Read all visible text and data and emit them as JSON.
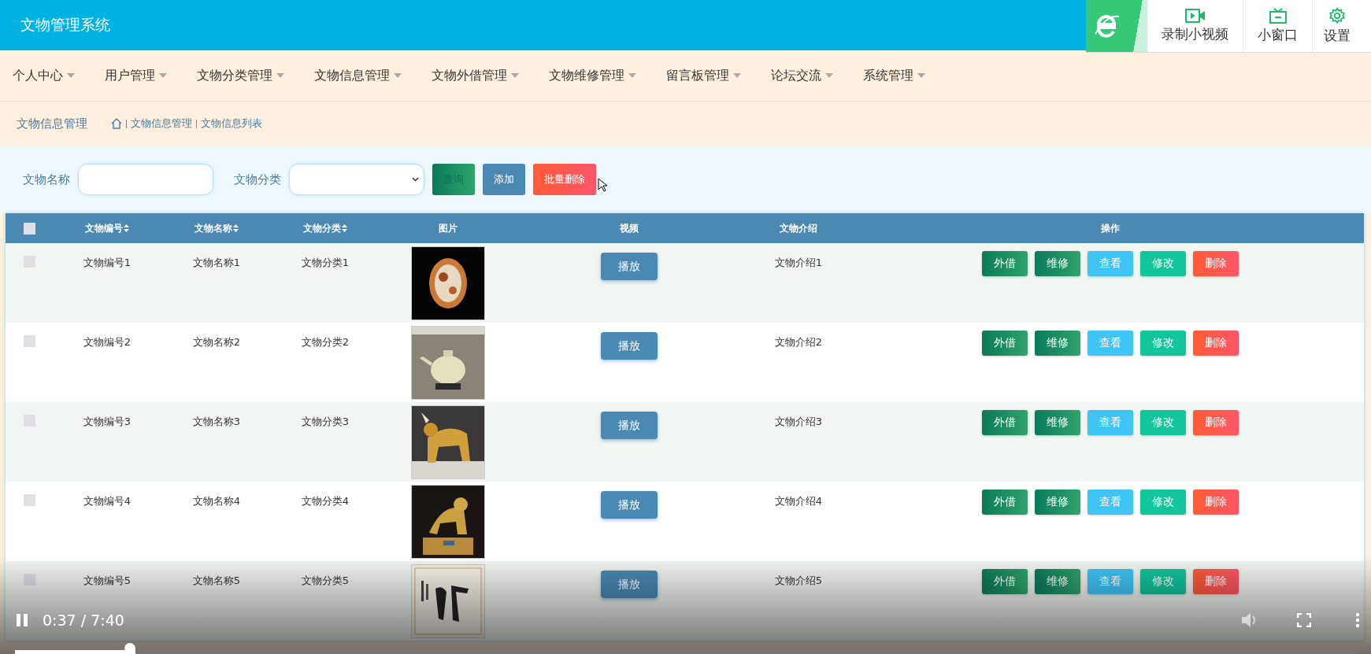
{
  "header": {
    "title": "文物管理系统"
  },
  "recorder_toolbar": {
    "items": [
      {
        "label": "录制小视频",
        "kind": "record"
      },
      {
        "label": "小窗口",
        "kind": "window"
      },
      {
        "label": "设置",
        "kind": "settings"
      }
    ]
  },
  "nav": {
    "items": [
      "个人中心",
      "用户管理",
      "文物分类管理",
      "文物信息管理",
      "文物外借管理",
      "文物维修管理",
      "留言板管理",
      "论坛交流",
      "系统管理"
    ]
  },
  "breadcrumb": {
    "title": "文物信息管理",
    "path": [
      "文物信息管理",
      "文物信息列表"
    ]
  },
  "search": {
    "fields": [
      {
        "label": "文物名称",
        "kind": "input"
      },
      {
        "label": "文物分类",
        "kind": "select"
      }
    ],
    "buttons": [
      {
        "label": "查询",
        "kind": "query"
      },
      {
        "label": "添加",
        "kind": "add"
      },
      {
        "label": "批量删除",
        "kind": "delete"
      }
    ]
  },
  "table": {
    "select_all": {
      "checked": false
    },
    "columns": [
      {
        "label": "文物编号",
        "sortable": true
      },
      {
        "label": "文物名称",
        "sortable": true
      },
      {
        "label": "文物分类",
        "sortable": true
      },
      {
        "label": "图片",
        "sortable": false
      },
      {
        "label": "视频",
        "sortable": false
      },
      {
        "label": "文物介绍",
        "sortable": false
      },
      {
        "label": "操作",
        "sortable": false
      }
    ],
    "rows": [
      {
        "checked": false,
        "cells": [
          "文物编号1",
          "文物名称1",
          "文物分类1"
        ],
        "video_button": "播放",
        "intro": "文物介绍1",
        "actions": [
          {
            "label": "外借",
            "kind": "lend"
          },
          {
            "label": "维修",
            "kind": "repair"
          },
          {
            "label": "查看",
            "kind": "view"
          },
          {
            "label": "修改",
            "kind": "edit"
          },
          {
            "label": "删除",
            "kind": "delete"
          }
        ]
      },
      {
        "checked": false,
        "cells": [
          "文物编号2",
          "文物名称2",
          "文物分类2"
        ],
        "video_button": "播放",
        "intro": "文物介绍2",
        "actions": [
          {
            "label": "外借",
            "kind": "lend"
          },
          {
            "label": "维修",
            "kind": "repair"
          },
          {
            "label": "查看",
            "kind": "view"
          },
          {
            "label": "修改",
            "kind": "edit"
          },
          {
            "label": "删除",
            "kind": "delete"
          }
        ]
      },
      {
        "checked": false,
        "cells": [
          "文物编号3",
          "文物名称3",
          "文物分类3"
        ],
        "video_button": "播放",
        "intro": "文物介绍3",
        "actions": [
          {
            "label": "外借",
            "kind": "lend"
          },
          {
            "label": "维修",
            "kind": "repair"
          },
          {
            "label": "查看",
            "kind": "view"
          },
          {
            "label": "修改",
            "kind": "edit"
          },
          {
            "label": "删除",
            "kind": "delete"
          }
        ]
      },
      {
        "checked": false,
        "cells": [
          "文物编号4",
          "文物名称4",
          "文物分类4"
        ],
        "video_button": "播放",
        "intro": "文物介绍4",
        "actions": [
          {
            "label": "外借",
            "kind": "lend"
          },
          {
            "label": "维修",
            "kind": "repair"
          },
          {
            "label": "查看",
            "kind": "view"
          },
          {
            "label": "修改",
            "kind": "edit"
          },
          {
            "label": "删除",
            "kind": "delete"
          }
        ]
      },
      {
        "checked": false,
        "cells": [
          "文物编号5",
          "文物名称5",
          "文物分类5"
        ],
        "video_button": "播放",
        "intro": "文物介绍5",
        "actions": [
          {
            "label": "外借",
            "kind": "lend"
          },
          {
            "label": "维修",
            "kind": "repair"
          },
          {
            "label": "查看",
            "kind": "view"
          },
          {
            "label": "修改",
            "kind": "edit"
          },
          {
            "label": "删除",
            "kind": "delete"
          }
        ]
      }
    ]
  },
  "video_player": {
    "playing": true,
    "time": "0:37 / 7:40",
    "level": 0.09
  }
}
